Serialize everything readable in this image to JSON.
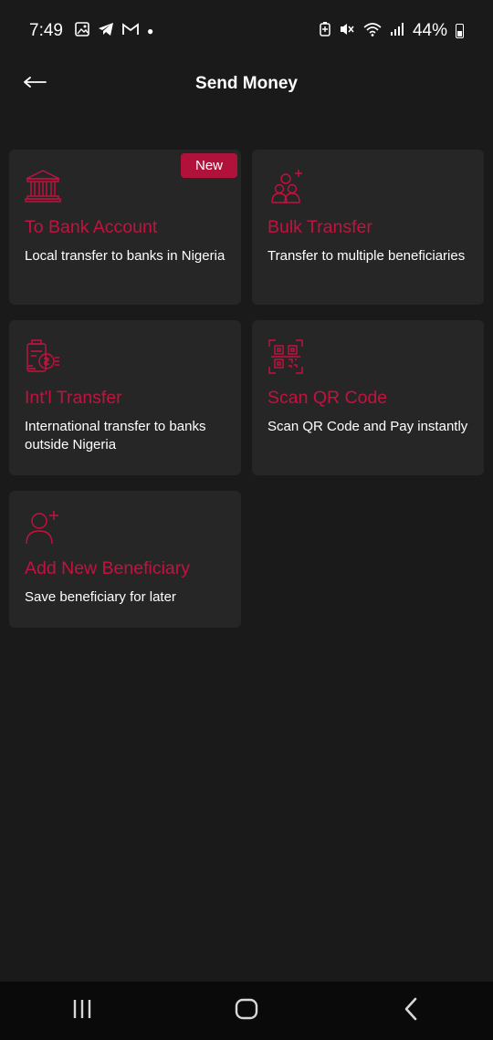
{
  "status_bar": {
    "time": "7:49",
    "battery": "44%",
    "icons": [
      "image-icon",
      "telegram-icon",
      "gmail-icon",
      "dot-icon",
      "battery-saver-icon",
      "mute-icon",
      "wifi-icon",
      "signal-icon",
      "battery-icon"
    ]
  },
  "header": {
    "title": "Send Money",
    "back_icon": "arrow-left-icon"
  },
  "options": [
    {
      "title": "To Bank Account",
      "description": "Local transfer to banks in Nigeria",
      "badge": "New",
      "icon": "bank-icon"
    },
    {
      "title": "Bulk Transfer",
      "description": "Transfer to multiple beneficiaries",
      "icon": "users-plus-icon"
    },
    {
      "title": "Int'l Transfer",
      "description": "International transfer to banks outside Nigeria",
      "icon": "international-transfer-icon"
    },
    {
      "title": "Scan QR Code",
      "description": "Scan QR Code and Pay instantly",
      "icon": "qr-code-icon"
    },
    {
      "title": "Add New Beneficiary",
      "description": "Save beneficiary for later",
      "icon": "add-user-icon"
    }
  ],
  "colors": {
    "accent": "#c4123f",
    "badge": "#b0123c",
    "background": "#1a1a1a",
    "card": "#262626"
  },
  "navigation": {
    "icons": [
      "recent-apps-icon",
      "home-icon",
      "back-icon"
    ]
  }
}
